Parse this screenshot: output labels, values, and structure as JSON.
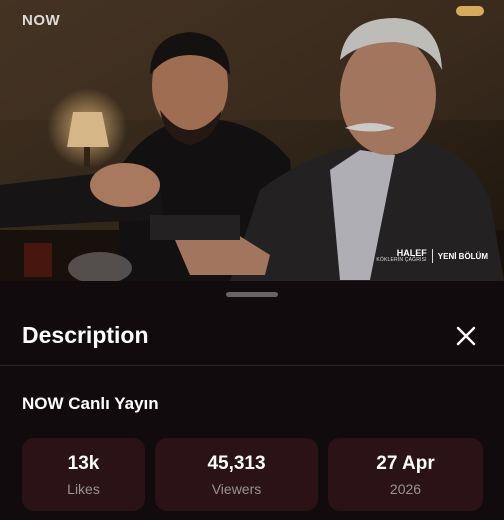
{
  "video": {
    "logo": "NOW",
    "badge": {
      "title": "HALEF",
      "subtitle": "KÖKLERİN ÇAĞRISI",
      "tag": "YENİ BÖLÜM"
    }
  },
  "sheet": {
    "title": "Description",
    "channel": "NOW Canlı Yayın",
    "stats": [
      {
        "value": "13k",
        "label": "Likes"
      },
      {
        "value": "45,313",
        "label": "Viewers"
      },
      {
        "value": "27 Apr",
        "label": "2026"
      }
    ]
  },
  "colors": {
    "sheet_bg": "#120b0e",
    "card_bg": "#2b1216",
    "label": "#9b9293"
  },
  "icons": {
    "close": "close-icon",
    "handle": "drag-handle"
  }
}
